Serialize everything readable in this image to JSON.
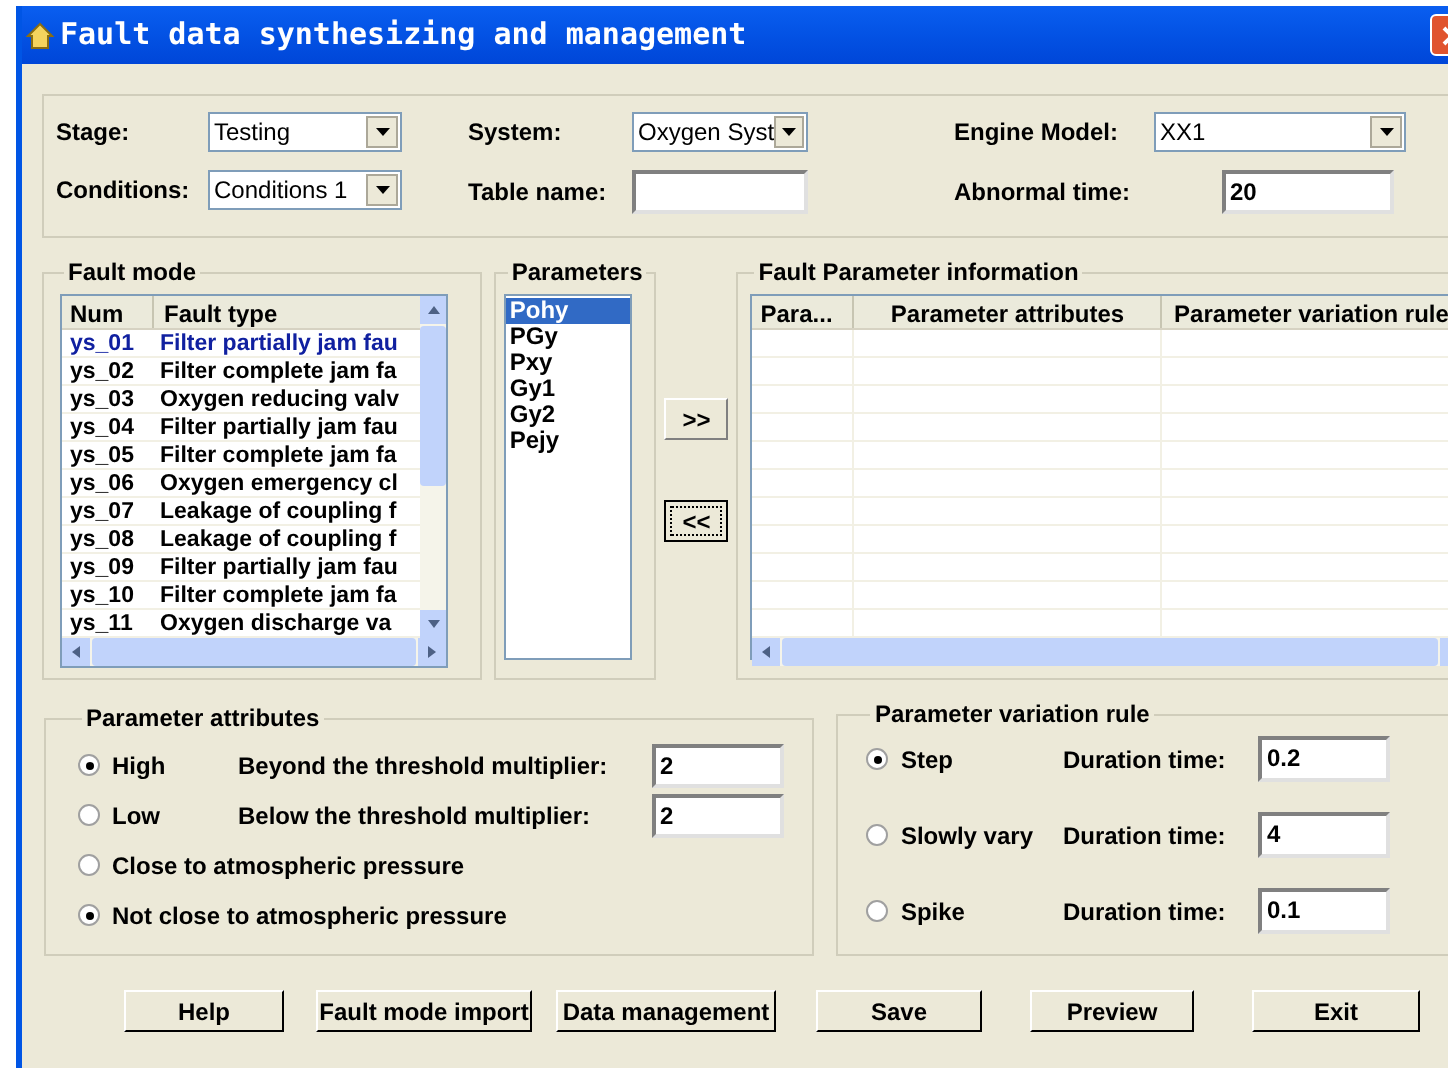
{
  "window": {
    "title": "Fault data synthesizing and management"
  },
  "top": [
    {
      "label": "Stage:",
      "kind": "dropdown",
      "value": "Testing"
    },
    {
      "label": "System:",
      "kind": "dropdown",
      "value": "Oxygen Syst"
    },
    {
      "label": "Engine Model:",
      "kind": "dropdown",
      "value": "XX1"
    },
    {
      "label": "Conditions:",
      "kind": "dropdown",
      "value": "Conditions 1"
    },
    {
      "label": "Table name:",
      "kind": "text"
    },
    {
      "label": "Abnormal time:",
      "kind": "text",
      "value": "20"
    }
  ],
  "fault_mode": {
    "title": "Fault mode",
    "columns": [
      "Num",
      "Fault type"
    ],
    "rows": [
      {
        "num": "ys_01",
        "type": "Filter partially jam fau",
        "selected": true
      },
      {
        "num": "ys_02",
        "type": "Filter complete jam fa",
        "selected": false
      },
      {
        "num": "ys_03",
        "type": "Oxygen reducing valv",
        "selected": false
      },
      {
        "num": "ys_04",
        "type": "Filter partially jam fau",
        "selected": false
      },
      {
        "num": "ys_05",
        "type": "Filter complete jam fa",
        "selected": false
      },
      {
        "num": "ys_06",
        "type": "Oxygen emergency cl",
        "selected": false
      },
      {
        "num": "ys_07",
        "type": "Leakage of coupling f",
        "selected": false
      },
      {
        "num": "ys_08",
        "type": "Leakage of coupling f",
        "selected": false
      },
      {
        "num": "ys_09",
        "type": "Filter partially jam fau",
        "selected": false
      },
      {
        "num": "ys_10",
        "type": "Filter complete jam fa",
        "selected": false
      },
      {
        "num": "ys_11",
        "type": "Oxygen discharge va",
        "selected": false
      }
    ]
  },
  "parameters": {
    "title": "Parameters",
    "items": [
      {
        "label": "Pohy",
        "selected": true
      },
      {
        "label": "PGy",
        "selected": false
      },
      {
        "label": "Pxy",
        "selected": false
      },
      {
        "label": "Gy1",
        "selected": false
      },
      {
        "label": "Gy2",
        "selected": false
      },
      {
        "label": "Pejy",
        "selected": false
      }
    ]
  },
  "transfer_buttons": [
    ">>",
    "<<"
  ],
  "fault_parameter_info": {
    "title": "Fault Parameter information",
    "columns": [
      "Para...",
      "Parameter attributes",
      "Parameter variation rule"
    ]
  },
  "parameter_attributes": {
    "title": "Parameter attributes",
    "options": [
      {
        "label": "High",
        "selected": true,
        "field_label": "Beyond the threshold multiplier:",
        "value": "2"
      },
      {
        "label": "Low",
        "selected": false,
        "field_label": "Below the threshold multiplier:",
        "value": "2"
      },
      {
        "label": "Close to atmospheric pressure",
        "selected": false
      },
      {
        "label": "Not close to atmospheric pressure",
        "selected": true
      }
    ]
  },
  "parameter_variation_rule": {
    "title": "Parameter variation rule",
    "options": [
      {
        "label": "Step",
        "selected": true,
        "field_label": "Duration time:",
        "value": "0.2"
      },
      {
        "label": "Slowly vary",
        "selected": false,
        "field_label": "Duration time:",
        "value": "4"
      },
      {
        "label": "Spike",
        "selected": false,
        "field_label": "Duration time:",
        "value": "0.1"
      }
    ]
  },
  "buttons": [
    "Help",
    "Fault mode import",
    "Data management",
    "Save",
    "Preview",
    "Exit"
  ]
}
